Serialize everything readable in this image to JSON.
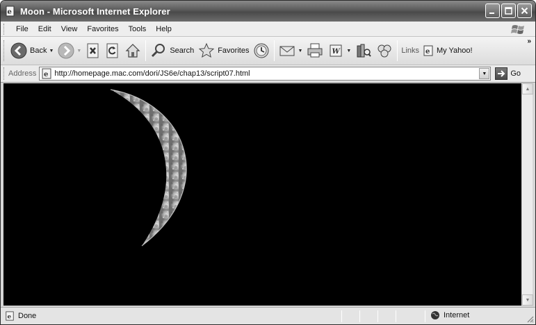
{
  "window": {
    "title": "Moon - Microsoft Internet Explorer"
  },
  "menu": {
    "items": [
      "File",
      "Edit",
      "View",
      "Favorites",
      "Tools",
      "Help"
    ]
  },
  "toolbar": {
    "back_label": "Back",
    "search_label": "Search",
    "favorites_label": "Favorites",
    "links_label": "Links",
    "link_item": "My Yahoo!"
  },
  "address": {
    "label": "Address",
    "url": "http://homepage.mac.com/dori/JS6e/chap13/script07.html",
    "go_label": "Go"
  },
  "content": {
    "image_name": "moon-crescent",
    "background": "#000000"
  },
  "status": {
    "text": "Done",
    "zone": "Internet"
  },
  "colors": {
    "titlebar": "#5a5a5a",
    "content_bg": "#000000",
    "chrome": "#d6d6d6"
  }
}
